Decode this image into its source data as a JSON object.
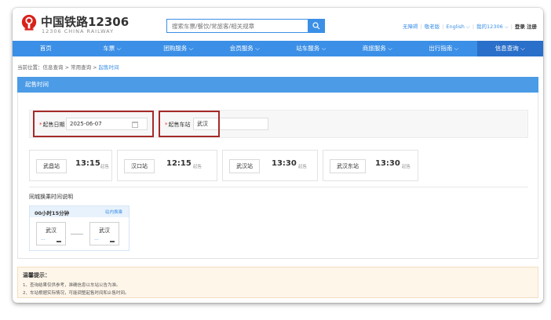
{
  "header": {
    "brand_cn": "中国铁路12306",
    "brand_en": "12306 CHINA RAILWAY",
    "search_placeholder": "搜索车票/餐饮/常旅客/相关规章",
    "links": {
      "care": "无障碍",
      "elder": "敬老版",
      "lang": "English ⌵",
      "my12306": "我的12306 ⌵",
      "login": "登录",
      "register": "注册"
    },
    "logo_color": "#d8231b",
    "accent": "#3b8fe6"
  },
  "nav": {
    "items": [
      "首页",
      "车票 ⌵",
      "团购服务 ⌵",
      "会员服务 ⌵",
      "站车服务 ⌵",
      "商旅服务 ⌵",
      "出行指南 ⌵",
      "信息查询 ⌵"
    ]
  },
  "breadcrumb": {
    "prefix": "当前位置：信息查询 > 常用查询 > ",
    "current": "起售时间"
  },
  "panel": {
    "title": "起售时间"
  },
  "form": {
    "date_label": "起售日期",
    "date_value": "2025-06-07",
    "station_label": "起售车站",
    "station_value": "武汉"
  },
  "stations": [
    {
      "name": "武昌站",
      "time": "13:15",
      "suffix": "起售"
    },
    {
      "name": "汉口站",
      "time": "12:15",
      "suffix": "起售"
    },
    {
      "name": "武汉站",
      "time": "13:30",
      "suffix": "起售"
    },
    {
      "name": "武汉东站",
      "time": "13:30",
      "suffix": "起售"
    }
  ],
  "transfer": {
    "section_title": "同城换乘时间说明",
    "duration": "00小时15分钟",
    "type": "站内换乘",
    "from": "武汉",
    "to": "武汉"
  },
  "tips": {
    "title": "温馨提示：",
    "lines": [
      "1、查询结果仅供参考，准确信息以车站公告为准。",
      "2、车站根据实际情况，可能调整起售时间和止售时间。"
    ]
  }
}
